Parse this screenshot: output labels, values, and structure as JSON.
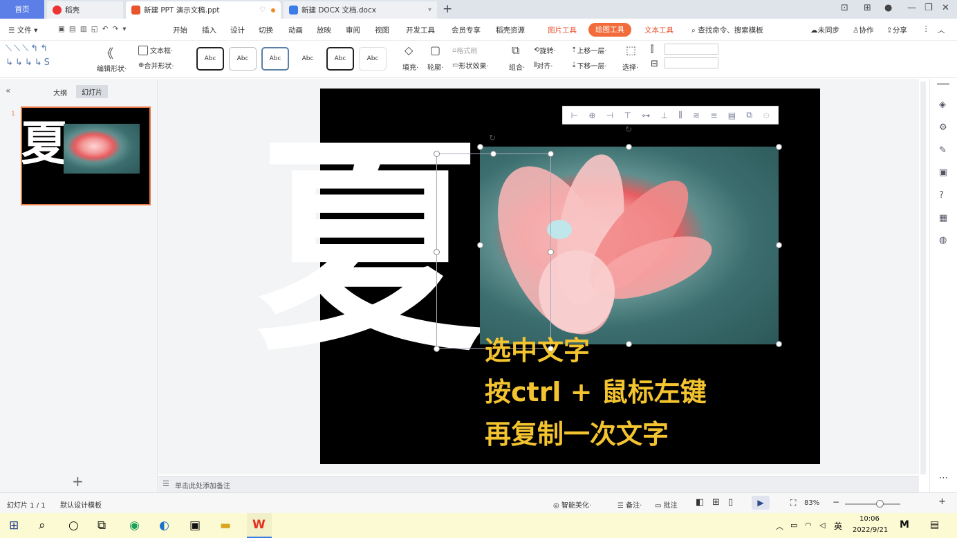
{
  "tabs": {
    "home": "首页",
    "daoke": "稻壳",
    "ppt": "新建 PPT 演示文稿.ppt",
    "docx": "新建 DOCX 文档.docx",
    "add": "+"
  },
  "menu": {
    "file": "文件",
    "items": [
      "开始",
      "插入",
      "设计",
      "切换",
      "动画",
      "放映",
      "审阅",
      "视图",
      "开发工具",
      "会员专享",
      "稻壳资源"
    ],
    "picture_tools": "图片工具",
    "drawing_tools": "绘图工具",
    "text_tools": "文本工具",
    "search": "查找命令、搜索模板",
    "unsynced": "未同步",
    "collab": "协作",
    "share": "分享"
  },
  "ribbon": {
    "edit_shape": "编辑形状·",
    "textbox": "文本框·",
    "merge_shape": "合并形状·",
    "style_label": "Abc",
    "fill": "填充·",
    "outline": "轮廓·",
    "format_brush": "格式刷",
    "shape_effect": "形状效果·",
    "group": "组合·",
    "rotate": "旋转·",
    "align": "对齐·",
    "bring_forward": "上移一层·",
    "send_backward": "下移一层·",
    "select": "选择·"
  },
  "leftpane": {
    "outline_tab": "大纲",
    "slides_tab": "幻灯片",
    "slide_number": "1",
    "add": "+"
  },
  "slide": {
    "big_char": "夏",
    "lines": [
      "选中文字",
      "按ctrl + 鼠标左键",
      "再复制一次文字"
    ]
  },
  "notes": {
    "placeholder": "单击此处添加备注"
  },
  "status": {
    "slide_count": "幻灯片 1 / 1",
    "template": "默认设计模板",
    "smart_beautify": "智能美化·",
    "notes": "备注·",
    "comment": "批注",
    "zoom": "83%"
  },
  "taskbar": {
    "lang": "英",
    "time": "10:06",
    "date": "2022/9/21"
  },
  "colors": {
    "accent_orange": "#f26b3a",
    "home_tab_blue": "#5b7fe6",
    "slide_text_yellow": "#f4c430"
  }
}
